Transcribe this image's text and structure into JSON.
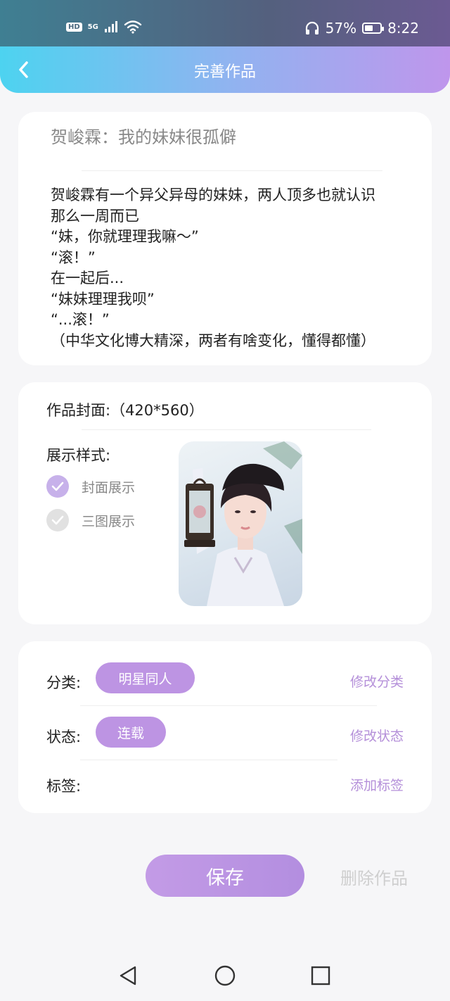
{
  "status_bar": {
    "hd": "HD",
    "network": "5G",
    "battery_percent": "57%",
    "battery_level": 0.57,
    "time": "8:22",
    "icons": [
      "signal-icon",
      "wifi-icon",
      "headphones-icon",
      "battery-icon"
    ]
  },
  "header": {
    "title": "完善作品",
    "back_icon": "back-arrow-icon"
  },
  "work": {
    "title": "贺峻霖：我的妹妹很孤僻",
    "synopsis_lines": [
      "贺峻霖有一个异父异母的妹妹，两人顶多也就认识",
      "那么一周而已",
      "“妹，你就理理我嘛～”",
      "“滚！”",
      "在一起后...",
      "“妹妹理理我呗”",
      "“...滚！”",
      "（中华文化博大精深，两者有啥变化，懂得都懂）"
    ]
  },
  "cover": {
    "label": "作品封面:（420*560）",
    "style_label": "展示样式:",
    "options": [
      {
        "label": "封面展示",
        "selected": true
      },
      {
        "label": "三图展示",
        "selected": false
      }
    ]
  },
  "meta": {
    "category_label": "分类:",
    "category_value": "明星同人",
    "category_action": "修改分类",
    "status_label": "状态:",
    "status_value": "连载",
    "status_action": "修改状态",
    "tags_label": "标签:",
    "tags_action": "添加标签"
  },
  "actions": {
    "save": "保存",
    "delete": "删除作品"
  },
  "colors": {
    "accent": "#bd94e3",
    "header_gradient_start": "#4dd3f0",
    "header_gradient_end": "#bf96ec",
    "status_bar": "#54607e"
  }
}
